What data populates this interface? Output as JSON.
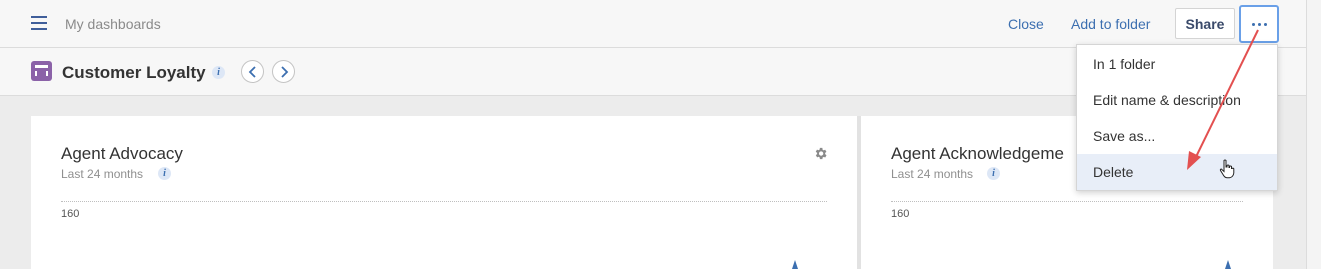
{
  "header": {
    "breadcrumb": "My dashboards",
    "close_label": "Close",
    "add_to_folder_label": "Add to folder",
    "share_label": "Share"
  },
  "dashboard": {
    "title": "Customer Loyalty",
    "info_symbol": "i"
  },
  "cards": [
    {
      "title": "Agent Advocacy",
      "subtitle": "Last 24 months",
      "y_tick": "160"
    },
    {
      "title": "Agent Acknowledgeme",
      "subtitle": "Last 24 months",
      "y_tick": "160"
    }
  ],
  "more_menu": {
    "items": [
      {
        "label": "In 1 folder"
      },
      {
        "label": "Edit name & description"
      },
      {
        "label": "Save as..."
      },
      {
        "label": "Delete"
      }
    ],
    "highlighted": "Delete"
  },
  "colors": {
    "accent": "#3c6fb0",
    "dashboard_icon": "#8b62a8",
    "annotation_arrow": "#e35050",
    "focus_ring": "#6aa0e8",
    "hover_row": "#e8eef8"
  },
  "icons": [
    "hamburger-menu-icon",
    "dashboard-icon",
    "info-icon",
    "chevron-left-icon",
    "chevron-right-icon",
    "gear-icon",
    "more-dots-icon",
    "hand-cursor-icon"
  ]
}
